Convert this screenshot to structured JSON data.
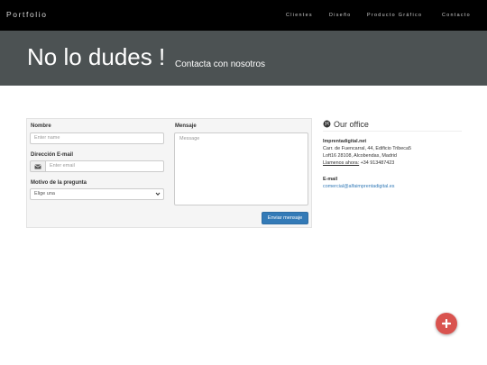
{
  "navbar": {
    "brand": "Portfolio",
    "items": [
      "Clientes",
      "Diseño",
      "Producto Gráfico",
      "Contacto"
    ]
  },
  "hero": {
    "title": "No lo dudes !",
    "subtitle": "Contacta con nosotros"
  },
  "form": {
    "name_label": "Nombre",
    "name_placeholder": "Enter name",
    "email_label": "Dirección E-mail",
    "email_placeholder": "Enter email",
    "reason_label": "Motivo de la pregunta",
    "reason_selected": "Elige una",
    "message_label": "Mensaje",
    "message_placeholder": "Message",
    "submit_label": "Enviar mensaje"
  },
  "office": {
    "title": "Our office",
    "company": "Imprentadigital.net",
    "address_line1": "Carr. de Fuencarral, 44, Edificio Tribeca5",
    "address_line2": "Loft16 28108, Alcobendas, Madrid",
    "phone_label": "Llamenos ahora:",
    "phone": "+34 913487423",
    "email_heading": "E-mail",
    "email": "comercial@alfaimprentadigital.es"
  },
  "colors": {
    "navbar_bg": "#000000",
    "hero_bg": "#4c5253",
    "primary_button": "#337ab7",
    "fab": "#d9534f"
  },
  "icons": {
    "office": "globe-icon",
    "email_addon": "envelope-icon",
    "select": "chevron-down-icon",
    "fab": "plus-icon"
  }
}
